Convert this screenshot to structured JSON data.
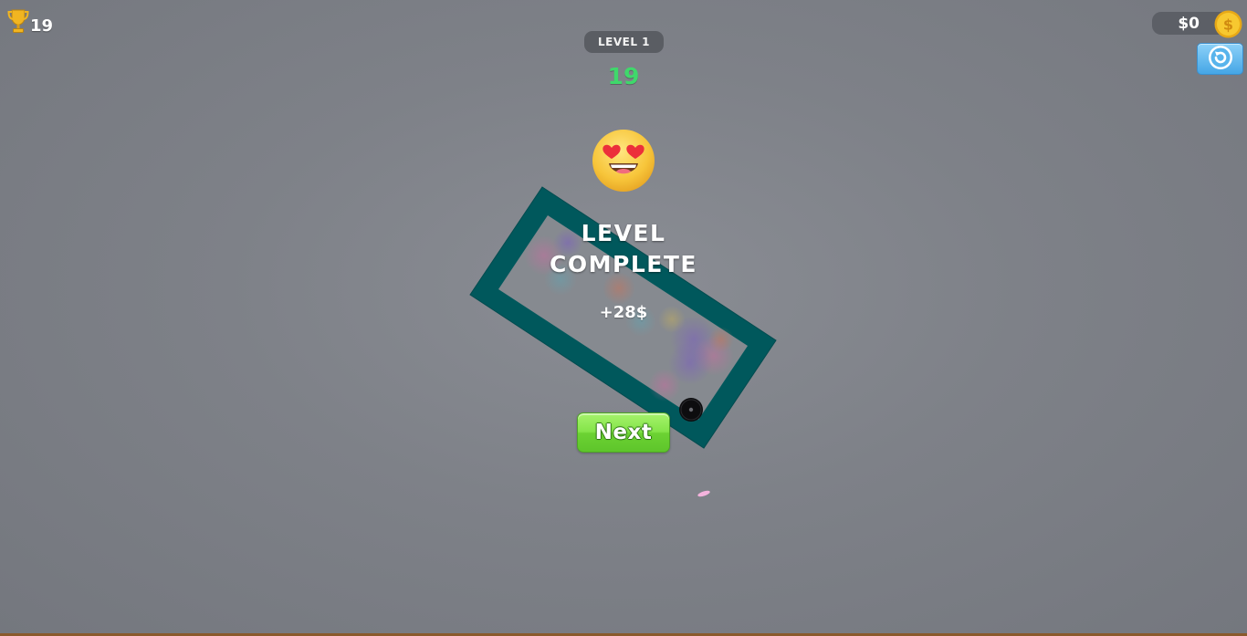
{
  "hud": {
    "trophy_count": "19",
    "level_label": "LEVEL 1",
    "score": "19",
    "money": "$0"
  },
  "result": {
    "title_line1": "LEVEL",
    "title_line2": "COMPLETE",
    "reward": "+28$"
  },
  "next_button": {
    "label": "Next"
  },
  "icons": {
    "trophy": "trophy-icon",
    "coin": "coin-icon",
    "restart": "restart-icon",
    "emoji": "heart-eyes-emoji-icon"
  },
  "colors": {
    "background": "#7e8188",
    "frame": "#005a5e",
    "score": "#3fd86b",
    "next_button": "#84e449",
    "restart_button": "#45a6e6",
    "coin": "#f5c027"
  }
}
